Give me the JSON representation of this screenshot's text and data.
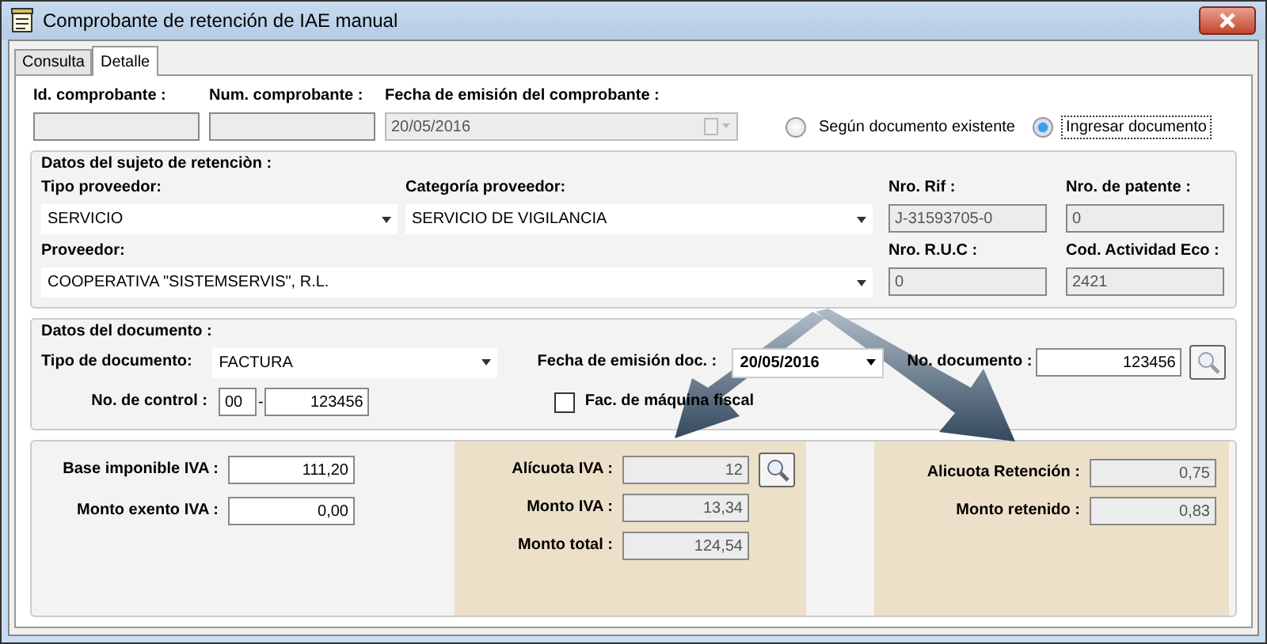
{
  "window": {
    "title": "Comprobante de retención de IAE manual"
  },
  "tabs": [
    {
      "label": "Consulta",
      "selected": false
    },
    {
      "label": "Detalle",
      "selected": true
    }
  ],
  "header": {
    "fields": [
      {
        "label": "Id. comprobante :",
        "disabled": true
      },
      {
        "label": "Num. comprobante :",
        "disabled": true
      }
    ],
    "date_field": {
      "label": "Fecha de emisión del comprobante :",
      "value": "20/05/2016",
      "disabled": true
    },
    "radios": [
      {
        "label": "Según documento existente",
        "selected": false
      },
      {
        "label": "Ingresar documento",
        "selected": true
      }
    ]
  },
  "subject": {
    "title": "Datos del sujeto de retenciòn :",
    "tipo_proveedor": {
      "label": "Tipo proveedor:",
      "value": "SERVICIO"
    },
    "categoria_proveedor": {
      "label": "Categoría proveedor:",
      "value": "SERVICIO DE VIGILANCIA"
    },
    "proveedor": {
      "label": "Proveedor:",
      "value": "COOPERATIVA \"SISTEMSERVIS\", R.L."
    },
    "id_fields": [
      {
        "label": "Nro. Rif :",
        "value": "J-31593705-0",
        "disabled": true
      },
      {
        "label": "Nro. de patente :",
        "value": "0",
        "disabled": true
      },
      {
        "label": "Nro. R.U.C :",
        "value": "0",
        "disabled": true
      },
      {
        "label": "Cod. Actividad Eco :",
        "value": "2421",
        "disabled": true
      }
    ]
  },
  "document": {
    "title": "Datos del documento :",
    "tipo_documento": {
      "label": "Tipo de documento:",
      "value": "FACTURA"
    },
    "fecha_emision": {
      "label": "Fecha de emisión doc. :",
      "value": "20/05/2016"
    },
    "numero": {
      "label": "No. documento :",
      "value": "123456"
    },
    "control": {
      "label": "No. de control :",
      "prefix": "00",
      "separator": "-",
      "value": "123456"
    },
    "fiscal_machine": {
      "label": "Fac. de máquina fiscal",
      "checked": false
    }
  },
  "amounts": {
    "base_fields": [
      {
        "label": "Base imponible IVA :",
        "value": "111,20",
        "disabled": false
      },
      {
        "label": "Monto exento IVA :",
        "value": "0,00",
        "disabled": false
      }
    ],
    "iva_fields": [
      {
        "label": "Alícuota IVA :",
        "value": "12",
        "disabled": true
      },
      {
        "label": "Monto IVA :",
        "value": "13,34",
        "disabled": true
      },
      {
        "label": "Monto total :",
        "value": "124,54",
        "disabled": true
      }
    ],
    "retention_fields": [
      {
        "label": "Alicuota Retención :",
        "value": "0,75",
        "disabled": true
      },
      {
        "label": "Monto retenido :",
        "value": "0,83",
        "disabled": true
      }
    ]
  }
}
